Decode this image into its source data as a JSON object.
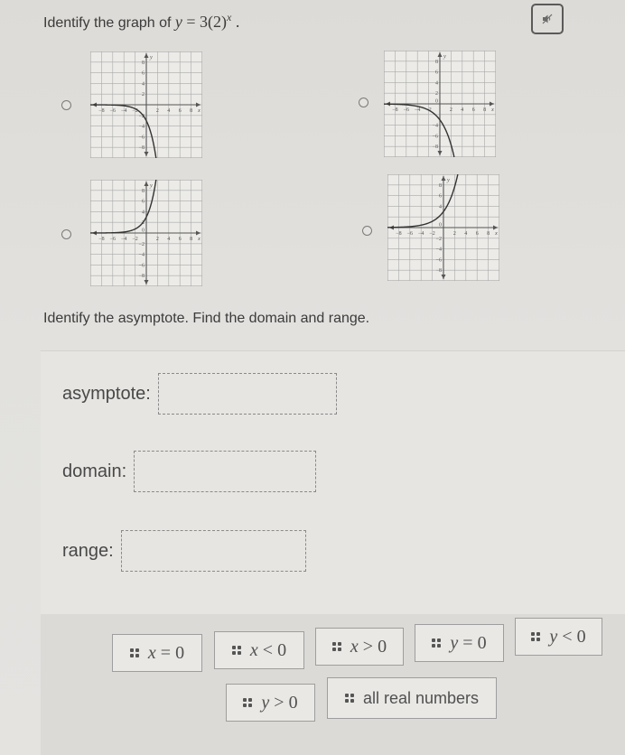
{
  "question": {
    "prompt_prefix": "Identify the graph of ",
    "equation": {
      "var": "y",
      "eq": " = 3(2)",
      "exponent": "x",
      "suffix": " ."
    }
  },
  "audio_button": {
    "icon": "speaker-muted-icon"
  },
  "graph_options": [
    {
      "id": "A",
      "selected": false,
      "function": "y = -3(2)^x",
      "chart_data": {
        "type": "line",
        "x_ticks": [
          "-8",
          "-6",
          "-4",
          "-2",
          "2",
          "4",
          "6",
          "8"
        ],
        "y_ticks": [
          "8",
          "6",
          "4",
          "2",
          "-2",
          "-4",
          "-6",
          "-8"
        ],
        "xlabel": "x",
        "ylabel": "y",
        "xlim": [
          -10,
          10
        ],
        "ylim": [
          -10,
          10
        ],
        "grid": true,
        "coef": -3,
        "base": 2
      }
    },
    {
      "id": "B",
      "selected": false,
      "function": "y = -3(1.5)^x",
      "chart_data": {
        "type": "line",
        "x_ticks": [
          "-8",
          "-6",
          "-4",
          "-2",
          "2",
          "4",
          "6",
          "8"
        ],
        "y_ticks": [
          "8",
          "6",
          "4",
          "2",
          "-4",
          "-6",
          "-8"
        ],
        "origin_label": "0",
        "xlabel": "x",
        "ylabel": "y",
        "xlim": [
          -10,
          10
        ],
        "ylim": [
          -10,
          10
        ],
        "grid": true,
        "coef": -3,
        "base": 1.6
      }
    },
    {
      "id": "C",
      "selected": false,
      "function": "y = 3(2)^x",
      "chart_data": {
        "type": "line",
        "x_ticks": [
          "-8",
          "-6",
          "-4",
          "-2",
          "2",
          "4",
          "6",
          "8"
        ],
        "y_ticks": [
          "8",
          "6",
          "4",
          "2",
          "-2",
          "-4",
          "-6",
          "-8"
        ],
        "origin_label": "0",
        "xlabel": "x",
        "ylabel": "y",
        "xlim": [
          -10,
          10
        ],
        "ylim": [
          -10,
          10
        ],
        "grid": true,
        "coef": 3,
        "base": 2
      }
    },
    {
      "id": "D",
      "selected": false,
      "function": "y = 3(1.5)^x",
      "chart_data": {
        "type": "line",
        "x_ticks": [
          "-8",
          "-6",
          "-4",
          "-2",
          "2",
          "4",
          "6",
          "8"
        ],
        "y_ticks": [
          "8",
          "6",
          "4",
          "-2",
          "-4",
          "-6",
          "-8"
        ],
        "origin_label": "0",
        "xlabel": "x",
        "ylabel": "y",
        "xlim": [
          -10,
          10
        ],
        "ylim": [
          -10,
          10
        ],
        "grid": true,
        "coef": 3,
        "base": 1.6
      }
    }
  ],
  "part2": {
    "prompt": "Identify the asymptote. Find the domain and range.",
    "fields": [
      {
        "label": "asymptote:",
        "value": ""
      },
      {
        "label": "domain:",
        "value": ""
      },
      {
        "label": "range:",
        "value": ""
      }
    ]
  },
  "answer_bank": {
    "tiles": [
      {
        "label": "x = 0",
        "var": "x",
        "op": " = ",
        "rhs": "0",
        "kind": "math"
      },
      {
        "label": "x < 0",
        "var": "x",
        "op": " < ",
        "rhs": "0",
        "kind": "math"
      },
      {
        "label": "x > 0",
        "var": "x",
        "op": " > ",
        "rhs": "0",
        "kind": "math"
      },
      {
        "label": "y = 0",
        "var": "y",
        "op": " = ",
        "rhs": "0",
        "kind": "math"
      },
      {
        "label": "y < 0",
        "var": "y",
        "op": " < ",
        "rhs": "0",
        "kind": "math"
      },
      {
        "label": "y > 0",
        "var": "y",
        "op": " > ",
        "rhs": "0",
        "kind": "math"
      },
      {
        "label": "all real numbers",
        "kind": "text"
      }
    ]
  }
}
